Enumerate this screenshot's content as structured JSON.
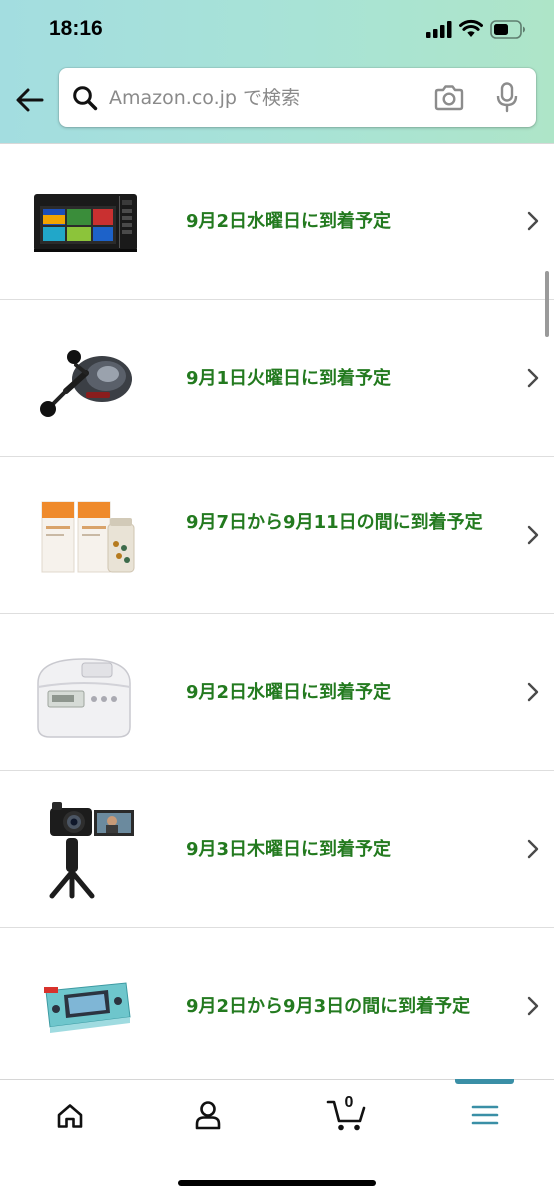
{
  "status_bar": {
    "time": "18:16"
  },
  "search": {
    "placeholder": "Amazon.co.jp で検索",
    "value": ""
  },
  "orders": [
    {
      "product": "Panasonic microwave oven",
      "delivery": "9月2日水曜日に到着予定"
    },
    {
      "product": "baitcasting fishing reel",
      "delivery": "9月1日火曜日に到着予定"
    },
    {
      "product": "HELIOCARE supplement boxes",
      "delivery": "9月7日から9月11日の間に到着予定"
    },
    {
      "product": "white rice cooker",
      "delivery": "9月2日水曜日に到着予定"
    },
    {
      "product": "compact camera with tripod grip",
      "delivery": "9月3日木曜日に到着予定"
    },
    {
      "product": "Nintendo Switch Lite (turquoise)",
      "delivery": "9月2日から9月3日の間に到着予定"
    }
  ],
  "bottom_nav": {
    "items": [
      "home-icon",
      "account-icon",
      "cart-icon",
      "menu-icon"
    ],
    "cart_count": "0",
    "active": "menu"
  },
  "colors": {
    "delivery_text": "#237a1f",
    "header_gradient_start": "#a3dde0",
    "header_gradient_end": "#aee5c8",
    "nav_active": "#3a8fa6"
  }
}
